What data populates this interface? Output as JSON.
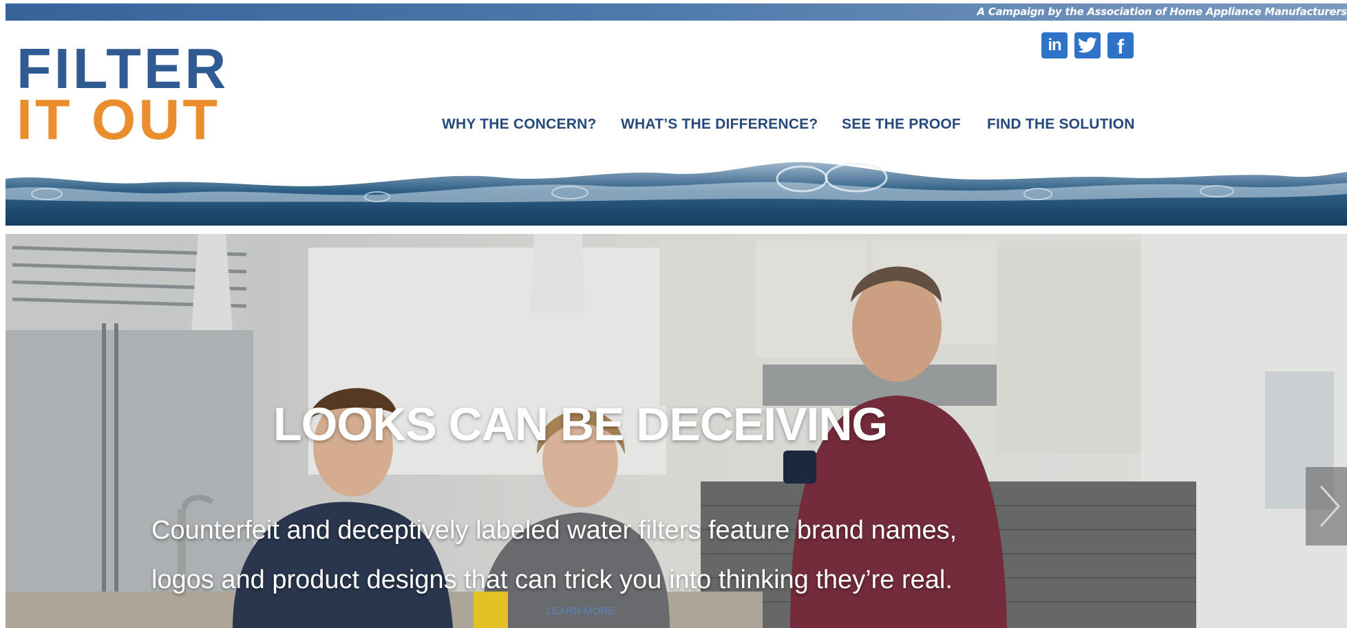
{
  "banner": {
    "tagline": "A Campaign by the Association of Home Appliance Manufacturers"
  },
  "logo": {
    "line1": "FILTER",
    "line2": "IT OUT"
  },
  "social": [
    {
      "icon": "linkedin-icon",
      "glyph": "in"
    },
    {
      "icon": "twitter-icon"
    },
    {
      "icon": "facebook-icon",
      "glyph": "f"
    }
  ],
  "nav": [
    {
      "label": "WHY THE CONCERN?"
    },
    {
      "label": "WHAT’S THE DIFFERENCE?"
    },
    {
      "label": "SEE THE PROOF"
    },
    {
      "label": "FIND THE SOLUTION"
    }
  ],
  "hero": {
    "title": "LOOKS CAN BE DECEIVING",
    "body_line1": "Counterfeit and deceptively labeled water filters feature brand names,",
    "body_line2": "logos and product designs that can trick you into thinking they’re real.",
    "cta": "LEARN MORE",
    "next_icon": "chevron-right-icon"
  },
  "colors": {
    "brand_blue": "#2f5b92",
    "brand_orange": "#ea8d2c",
    "nav_text": "#26497c",
    "social_bg": "#2f73c8",
    "link": "#5a83bf"
  }
}
